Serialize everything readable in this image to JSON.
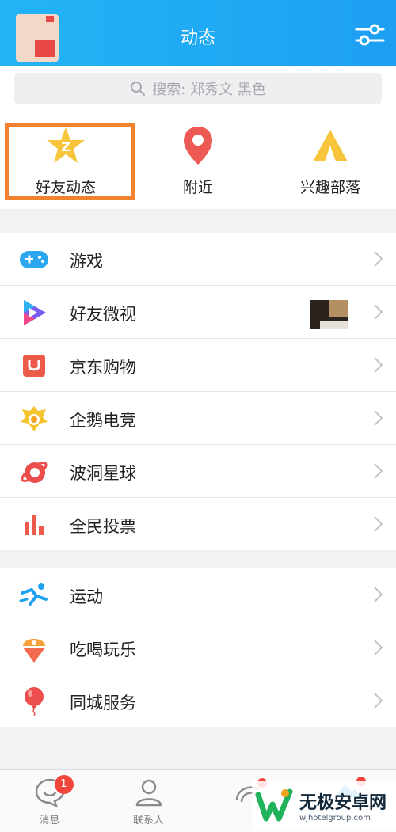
{
  "header": {
    "title": "动态",
    "avatar_icon": "avatar-image",
    "settings_icon": "sliders-icon"
  },
  "search": {
    "placeholder": "搜索: 郑秀文 黑色"
  },
  "quick": [
    {
      "label": "好友动态",
      "icon": "star-z-icon",
      "color": "#f7c53c",
      "highlighted": true
    },
    {
      "label": "附近",
      "icon": "location-pin-icon",
      "color": "#ec5a53"
    },
    {
      "label": "兴趣部落",
      "icon": "tent-icon",
      "color": "#f7c53c"
    }
  ],
  "group1": [
    {
      "label": "游戏",
      "icon": "gamepad-icon",
      "color": "#2aa7ef"
    },
    {
      "label": "好友微视",
      "icon": "weishi-play-icon",
      "color": "#7b5cf0"
    },
    {
      "label": "京东购物",
      "icon": "jd-bag-icon",
      "color": "#ec5a4a"
    },
    {
      "label": "企鹅电竞",
      "icon": "penguin-esports-icon",
      "color": "#f4c430"
    },
    {
      "label": "波洞星球",
      "icon": "planet-icon",
      "color": "#ec4d4d"
    },
    {
      "label": "全民投票",
      "icon": "bar-chart-icon",
      "color": "#ec5a4a"
    }
  ],
  "group2": [
    {
      "label": "运动",
      "icon": "running-icon",
      "color": "#1fa2ef"
    },
    {
      "label": "吃喝玩乐",
      "icon": "ice-cream-icon",
      "color": "#f7a13a"
    },
    {
      "label": "同城服务",
      "icon": "balloon-icon",
      "color": "#ec4d4d"
    }
  ],
  "tabs": [
    {
      "label": "消息",
      "icon": "chat-icon",
      "badge": "1"
    },
    {
      "label": "联系人",
      "icon": "contacts-icon"
    },
    {
      "label": "",
      "icon": "activity-icon",
      "dot": true
    },
    {
      "label": "",
      "icon": "mountain-icon",
      "dot": true
    }
  ],
  "watermark": {
    "name": "无极安卓网",
    "url": "wjhotelgroup.com"
  }
}
